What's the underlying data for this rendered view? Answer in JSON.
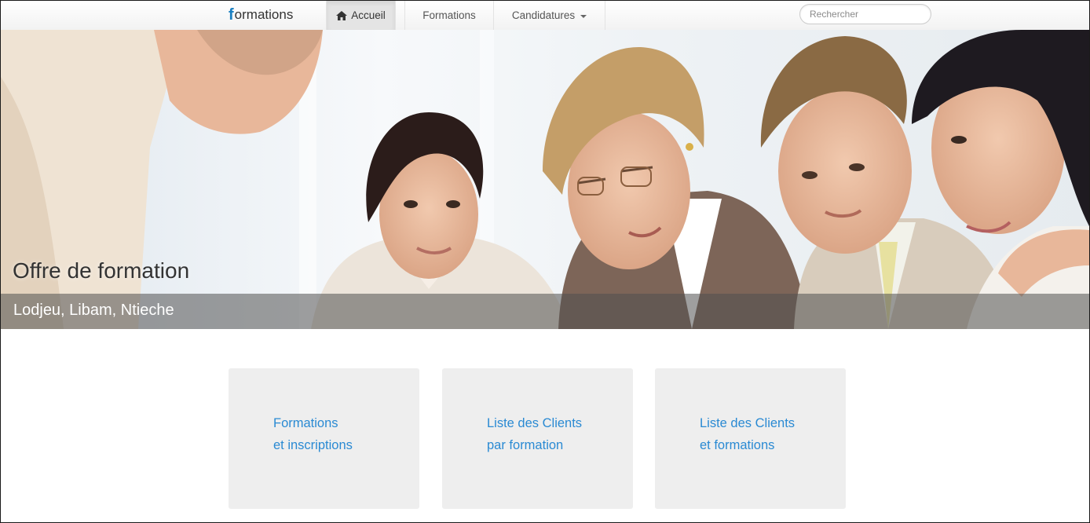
{
  "navbar": {
    "brand_initial": "f",
    "brand_rest": "ormations",
    "items": [
      {
        "label": "Accueil",
        "active": true,
        "icon": "home-icon"
      },
      {
        "label": "Formations",
        "active": false
      },
      {
        "label": "Candidatures",
        "active": false,
        "dropdown": true
      }
    ],
    "search_placeholder": "Rechercher"
  },
  "hero": {
    "title": "Offre de formation",
    "subtitle": "Lodjeu, Libam, Ntieche"
  },
  "tiles": [
    {
      "line1": "Formations",
      "line2": "et inscriptions"
    },
    {
      "line1": "Liste des Clients",
      "line2": "par formation"
    },
    {
      "line1": "Liste des Clients",
      "line2": "et formations"
    }
  ],
  "colors": {
    "brand": "#1a7fc1",
    "link": "#2a8ad3",
    "tile_bg": "#eeeeee",
    "nav_active_bg": "#e4e4e4"
  }
}
